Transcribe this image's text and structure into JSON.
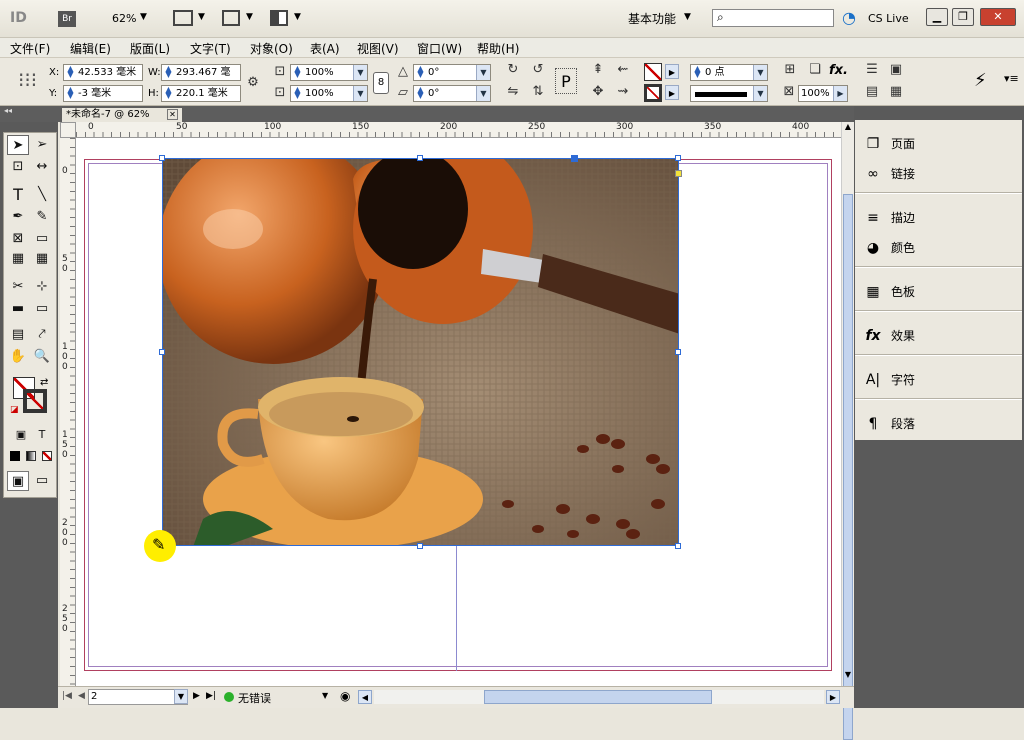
{
  "app": {
    "logo": "ID",
    "bridge": "Br",
    "zoom": "62%",
    "workspace": "基本功能",
    "search_placeholder": "",
    "cs_live": "CS Live"
  },
  "menu": [
    "文件(F)",
    "编辑(E)",
    "版面(L)",
    "文字(T)",
    "对象(O)",
    "表(A)",
    "视图(V)",
    "窗口(W)",
    "帮助(H)"
  ],
  "control": {
    "x_label": "X:",
    "x_value": "42.533 毫米",
    "y_label": "Y:",
    "y_value": "-3 毫米",
    "w_label": "W:",
    "w_value": "293.467 毫",
    "h_label": "H:",
    "h_value": "220.1 毫米",
    "scale_x": "100%",
    "scale_y": "100%",
    "rotate": "0°",
    "shear": "0°",
    "stroke_weight": "0 点",
    "opacity": "100%",
    "fx": "fx."
  },
  "document": {
    "tab_title": "*未命名-7 @ 62%",
    "ruler_top": [
      "0",
      "50",
      "100",
      "150",
      "200",
      "250",
      "300",
      "350",
      "400"
    ],
    "ruler_left": [
      "0",
      "5",
      "0",
      "1",
      "0",
      "0",
      "1",
      "5",
      "0",
      "2",
      "0",
      "0",
      "2",
      "5",
      "0"
    ]
  },
  "status": {
    "page": "2",
    "preflight": "无错误"
  },
  "panels": [
    {
      "icon": "page-icon",
      "label": "页面"
    },
    {
      "icon": "links-icon",
      "label": "链接"
    },
    {
      "icon": "stroke-icon",
      "label": "描边"
    },
    {
      "icon": "color-icon",
      "label": "颜色"
    },
    {
      "icon": "swatches-icon",
      "label": "色板"
    },
    {
      "icon": "effects-icon",
      "label": "效果"
    },
    {
      "icon": "character-icon",
      "label": "字符"
    },
    {
      "icon": "paragraph-icon",
      "label": "段落"
    }
  ]
}
